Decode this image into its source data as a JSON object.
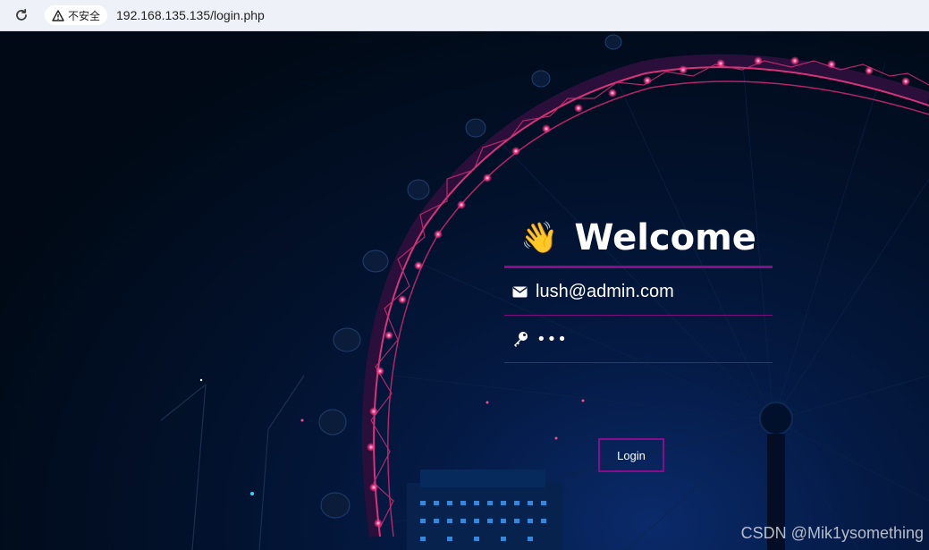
{
  "browser": {
    "reload_icon": "reload-icon",
    "security_label": "不安全",
    "url": "192.168.135.135/login.php"
  },
  "login": {
    "wave_emoji": "👋",
    "title": "Welcome",
    "email_value": "lush@admin.com",
    "password_mask": "•••",
    "button_label": "Login",
    "accent_color": "#8b0c8b"
  },
  "watermark": "CSDN @Mik1ysomething"
}
